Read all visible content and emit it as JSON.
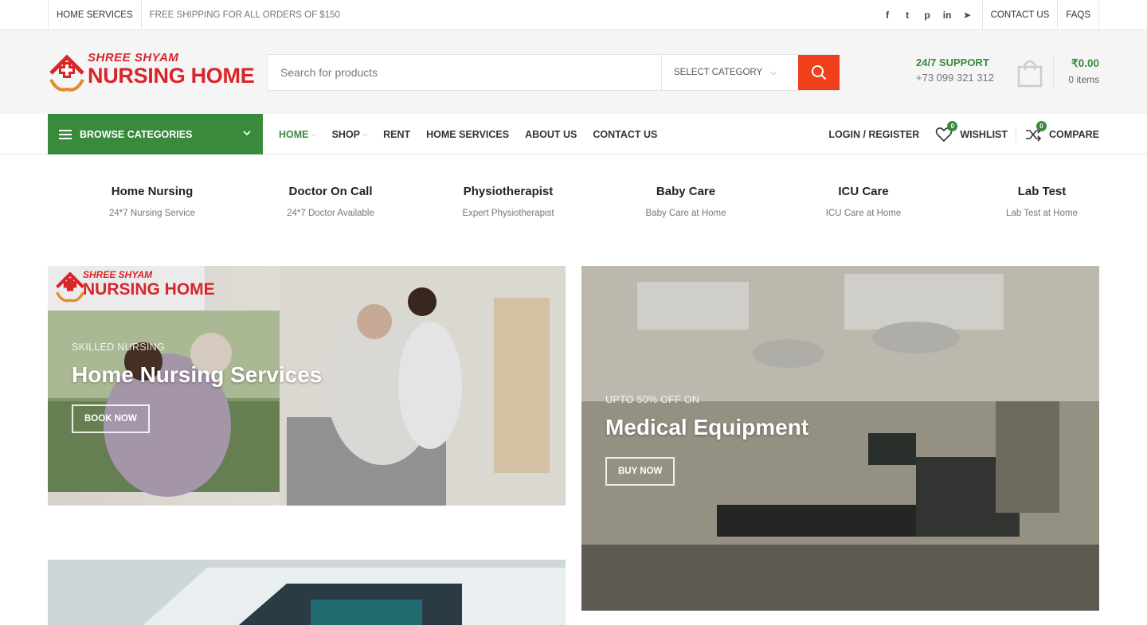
{
  "topbar": {
    "home_services": "HOME SERVICES",
    "shipping_note": "FREE SHIPPING FOR ALL ORDERS OF $150",
    "social": [
      "facebook-icon",
      "twitter-icon",
      "pinterest-icon",
      "linkedin-icon",
      "telegram-icon"
    ],
    "social_glyphs": [
      "f",
      "t",
      "p",
      "in",
      "➤"
    ],
    "contact": "CONTACT US",
    "faqs": "FAQS"
  },
  "header": {
    "logo_line1": "SHREE SHYAM",
    "logo_line2": "NURSING HOME",
    "search_placeholder": "Search for products",
    "category_label": "SELECT CATEGORY",
    "support_title": "24/7 SUPPORT",
    "support_phone": "+73 099 321 312",
    "cart_amount": "₹0.00",
    "cart_items": "0 items"
  },
  "nav": {
    "browse": "BROWSE CATEGORIES",
    "menu": [
      {
        "label": "HOME",
        "dropdown": true
      },
      {
        "label": "SHOP",
        "dropdown": true
      },
      {
        "label": "RENT",
        "dropdown": false
      },
      {
        "label": "HOME SERVICES",
        "dropdown": false
      },
      {
        "label": "ABOUT US",
        "dropdown": false
      },
      {
        "label": "CONTACT US",
        "dropdown": false
      }
    ],
    "login": "LOGIN / REGISTER",
    "wishlist": "WISHLIST",
    "wishlist_count": "0",
    "compare": "COMPARE",
    "compare_count": "0"
  },
  "services": [
    {
      "title": "Home Nursing",
      "subtitle": "24*7 Nursing Service"
    },
    {
      "title": "Doctor On Call",
      "subtitle": "24*7 Doctor Available"
    },
    {
      "title": "Physiotherapist",
      "subtitle": "Expert Physiotherapist"
    },
    {
      "title": "Baby Care",
      "subtitle": "Baby Care at Home"
    },
    {
      "title": "ICU Care",
      "subtitle": "ICU Care at Home"
    },
    {
      "title": "Lab Test",
      "subtitle": "Lab Test at Home"
    }
  ],
  "banners": [
    {
      "subtitle": "SKILLED NURSING",
      "title": "Home Nursing Services",
      "button": "BOOK NOW"
    },
    {
      "subtitle": "UPTO 50% OFF ON",
      "title": "Medical Equipment",
      "button": "BUY NOW"
    }
  ],
  "colors": {
    "accent": "#3a8a3e",
    "search_button": "#f0401b",
    "logo_red": "#d8252a"
  }
}
